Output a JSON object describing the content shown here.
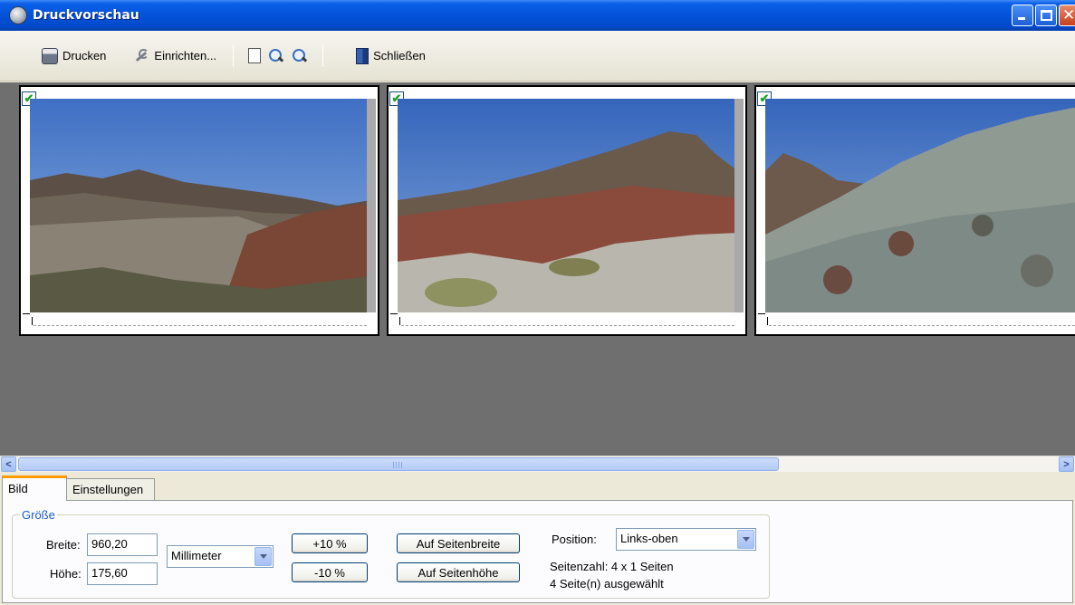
{
  "window": {
    "title": "Druckvorschau"
  },
  "toolbar": {
    "print_label": "Drucken",
    "setup_label": "Einrichten...",
    "close_label": "Schließen"
  },
  "pages": [
    {
      "checked": true
    },
    {
      "checked": true
    },
    {
      "checked": true
    }
  ],
  "tabs": [
    {
      "label": "Bild",
      "active": true
    },
    {
      "label": "Einstellungen",
      "active": false
    }
  ],
  "size_group": {
    "legend": "Größe",
    "width_label": "Breite:",
    "width_value": "960,20",
    "height_label": "Höhe:",
    "height_value": "175,60",
    "unit": "Millimeter",
    "plus_label": "+10 %",
    "minus_label": "-10 %",
    "fit_width_label": "Auf Seitenbreite",
    "fit_height_label": "Auf Seitenhöhe",
    "position_label": "Position:",
    "position_value": "Links-oben",
    "page_count_text": "Seitenzahl: 4 x 1 Seiten",
    "selected_text": "4 Seite(n) ausgewählt"
  },
  "colors": {
    "titlebar": "#0453d9",
    "preview_bg": "#6f6f6f",
    "accent_tab": "#ff9a00",
    "group_legend": "#1c5cd4"
  }
}
